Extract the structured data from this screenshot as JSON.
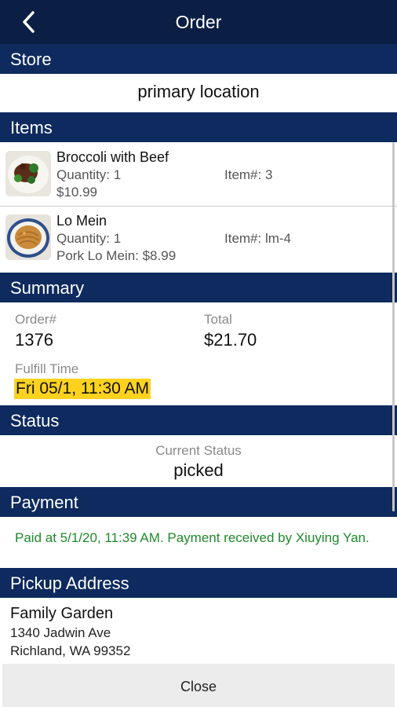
{
  "header": {
    "title": "Order",
    "back_icon": "chevron-left-icon"
  },
  "store": {
    "section_label": "Store",
    "location": "primary location"
  },
  "items": {
    "section_label": "Items",
    "list": [
      {
        "name": "Broccoli with Beef",
        "quantity": "Quantity: 1",
        "item_number": "Item#: 3",
        "price": "$10.99",
        "thumb": "broccoli-beef-dish-image"
      },
      {
        "name": "Lo Mein",
        "quantity": "Quantity: 1",
        "item_number": "Item#: lm-4",
        "price": "Pork Lo Mein: $8.99",
        "thumb": "lo-mein-dish-image"
      }
    ]
  },
  "summary": {
    "section_label": "Summary",
    "order_label": "Order#",
    "order_value": "1376",
    "total_label": "Total",
    "total_value": "$21.70",
    "fulfill_label": "Fulfill Time",
    "fulfill_value": "Fri 05/1, 11:30 AM",
    "fulfill_highlight_color": "#ffd21f"
  },
  "status": {
    "section_label": "Status",
    "current_label": "Current Status",
    "current_value": "picked"
  },
  "payment": {
    "section_label": "Payment",
    "text": "Paid at 5/1/20, 11:39 AM. Payment received by Xiuying Yan.",
    "text_color": "#1f8a2a"
  },
  "pickup": {
    "section_label": "Pickup Address",
    "name": "Family Garden",
    "line1": "1340 Jadwin Ave",
    "line2": "Richland, WA 99352"
  },
  "footer": {
    "close_label": "Close"
  },
  "colors": {
    "topbar": "#0b1f44",
    "section_header": "#0e2a5e"
  }
}
